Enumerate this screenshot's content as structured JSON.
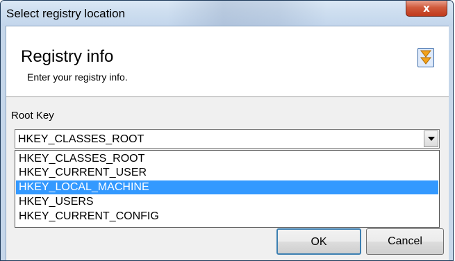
{
  "window": {
    "title": "Select registry location",
    "close_label": "x"
  },
  "header": {
    "title": "Registry info",
    "subtitle": "Enter your registry info.",
    "icon": "wizard-arrows-icon"
  },
  "root_key": {
    "label": "Root Key",
    "selected_value": "HKEY_CLASSES_ROOT",
    "options": [
      "HKEY_CLASSES_ROOT",
      "HKEY_CURRENT_USER",
      "HKEY_LOCAL_MACHINE",
      "HKEY_USERS",
      "HKEY_CURRENT_CONFIG"
    ],
    "highlighted_option": "HKEY_LOCAL_MACHINE"
  },
  "buttons": {
    "ok": "OK",
    "cancel": "Cancel"
  },
  "colors": {
    "selection": "#3399ff",
    "close_button": "#c0391b"
  }
}
